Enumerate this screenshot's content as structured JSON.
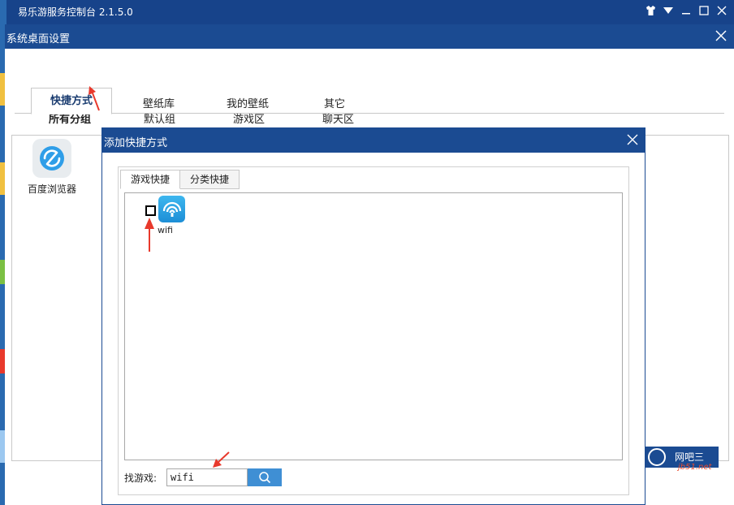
{
  "app": {
    "title": "易乐游服务控制台 2.1.5.0",
    "window_controls": [
      "shirt-icon",
      "dropdown-icon",
      "minimize-icon",
      "maximize-icon",
      "close-icon"
    ]
  },
  "settings_window": {
    "title": "系统桌面设置",
    "tabs": [
      {
        "label": "快捷方式",
        "active": true
      },
      {
        "label": "壁纸库",
        "active": false
      },
      {
        "label": "我的壁纸",
        "active": false
      },
      {
        "label": "其它",
        "active": false
      }
    ],
    "sub_tabs": [
      {
        "label": "所有分组",
        "active": true
      },
      {
        "label": "默认组",
        "active": false
      },
      {
        "label": "游戏区",
        "active": false
      },
      {
        "label": "聊天区",
        "active": false
      }
    ],
    "shortcuts": [
      {
        "label": "百度浏览器",
        "icon": "baidu-browser-icon"
      }
    ]
  },
  "dialog": {
    "title": "添加快捷方式",
    "tabs": [
      {
        "label": "游戏快捷",
        "active": true
      },
      {
        "label": "分类快捷",
        "active": false
      }
    ],
    "games": [
      {
        "label": "wifi",
        "checked": false,
        "icon": "wifi-icon"
      }
    ],
    "search": {
      "label": "找游戏:",
      "value": "wifi"
    }
  },
  "branding": {
    "text": "网吧三",
    "watermark": "jb51.net"
  },
  "colors": {
    "title_bar": "#17438a",
    "dialog_bar": "#1b4b92",
    "search_button": "#3f8fd4",
    "annotation_arrow": "#e8392c"
  }
}
